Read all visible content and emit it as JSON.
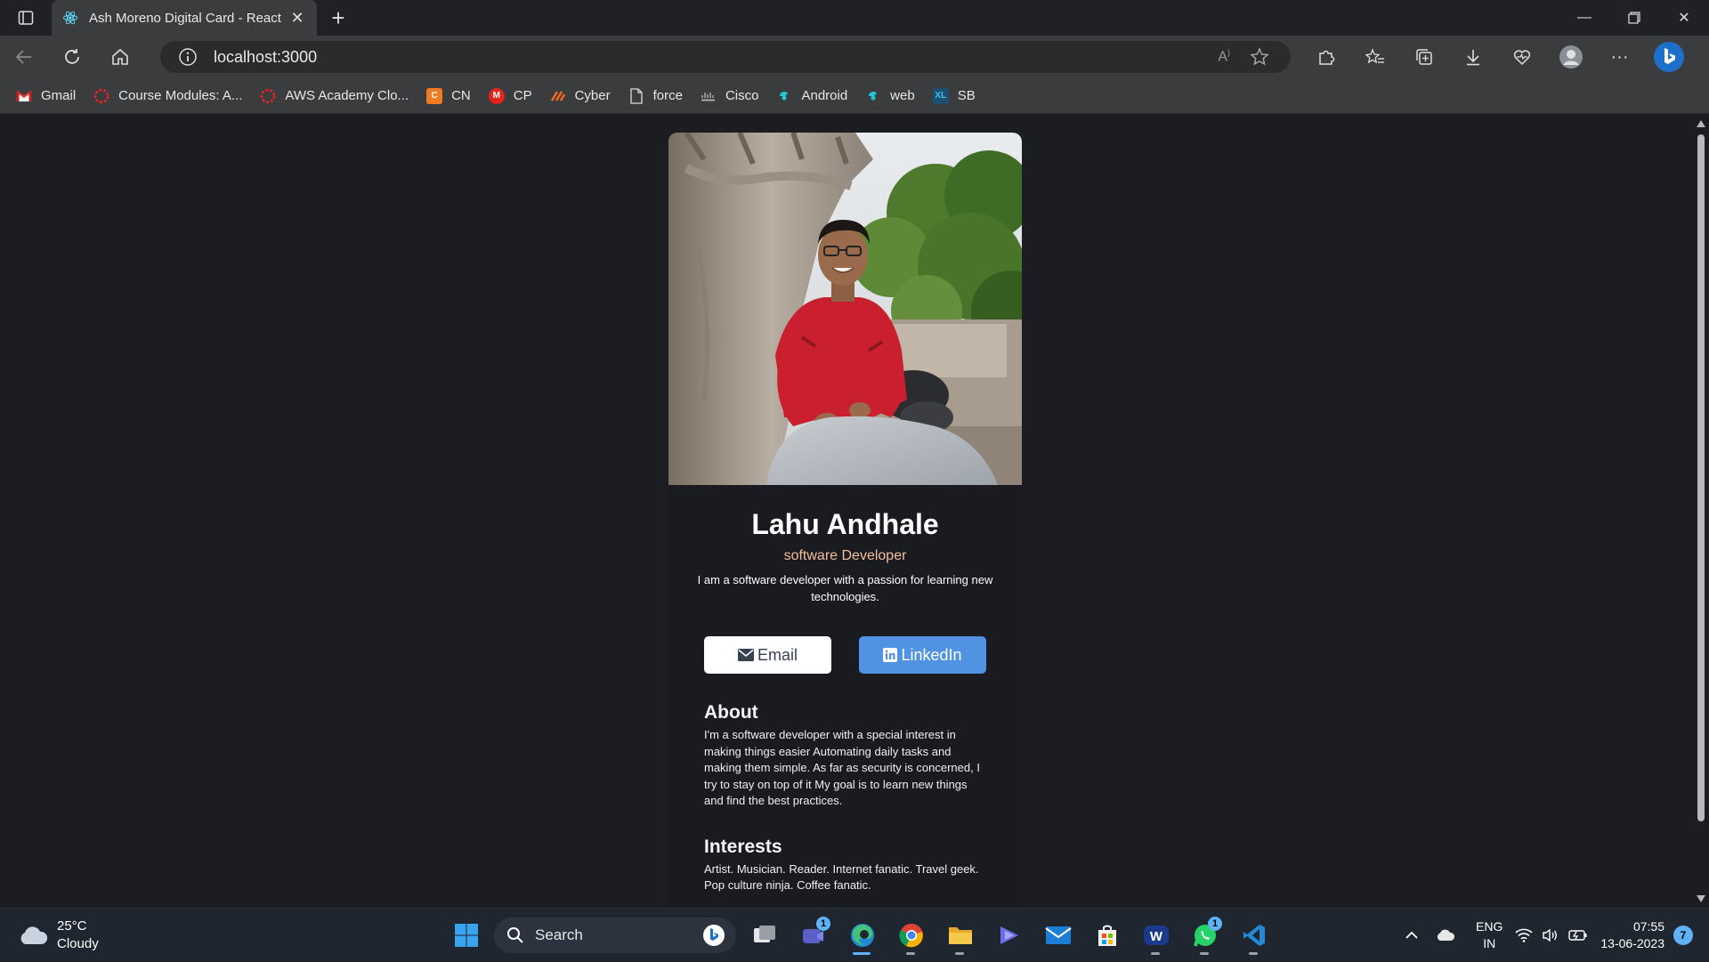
{
  "browser": {
    "tab_title": "Ash Moreno Digital Card - React",
    "url": "localhost:3000",
    "bookmarks": [
      {
        "label": "Gmail",
        "icon": "gmail-icon",
        "color": "#ea4335"
      },
      {
        "label": "Course Modules: A...",
        "icon": "canvas-icon",
        "color": "#e72429"
      },
      {
        "label": "AWS Academy Clo...",
        "icon": "canvas-icon",
        "color": "#e72429"
      },
      {
        "label": "CN",
        "icon": "cn-icon",
        "color": "#f07b22"
      },
      {
        "label": "CP",
        "icon": "cp-icon",
        "color": "#e2231a"
      },
      {
        "label": "Cyber",
        "icon": "cyber-icon",
        "color": "#f26b21"
      },
      {
        "label": "force",
        "icon": "page-icon",
        "color": "#dddddd"
      },
      {
        "label": "Cisco",
        "icon": "cisco-icon",
        "color": "#aaaaaa"
      },
      {
        "label": "Android",
        "icon": "android-icon",
        "color": "#22c6d8"
      },
      {
        "label": "web",
        "icon": "web-icon",
        "color": "#22c6d8"
      },
      {
        "label": "SB",
        "icon": "sb-icon",
        "color": "#2ab0e8"
      }
    ]
  },
  "card": {
    "name": "Lahu Andhale",
    "role": "software Developer",
    "bio": "I am a software developer with a passion for learning new technologies.",
    "email_label": "Email",
    "linkedin_label": "LinkedIn",
    "about_title": "About",
    "about_text": "I'm a software developer with a special interest in making things easier Automating daily tasks and making them simple. As far as security is concerned, I try to stay on top of it My goal is to learn new things and find the best practices.",
    "interests_title": "Interests",
    "interests_text": "Artist. Musician. Reader. Internet fanatic. Travel geek. Pop culture ninja. Coffee fanatic."
  },
  "colors": {
    "page_bg": "#1b1d23",
    "card_bg": "#1a1b21",
    "role_accent": "#f3bf99",
    "linkedin_button": "#5093e2"
  },
  "taskbar": {
    "weather_temp": "25°C",
    "weather_desc": "Cloudy",
    "search_placeholder": "Search",
    "lang_line1": "ENG",
    "lang_line2": "IN",
    "time": "07:55",
    "date": "13-06-2023",
    "notification_count": "7",
    "teams_badge": "1",
    "whatsapp_badge": "1"
  }
}
